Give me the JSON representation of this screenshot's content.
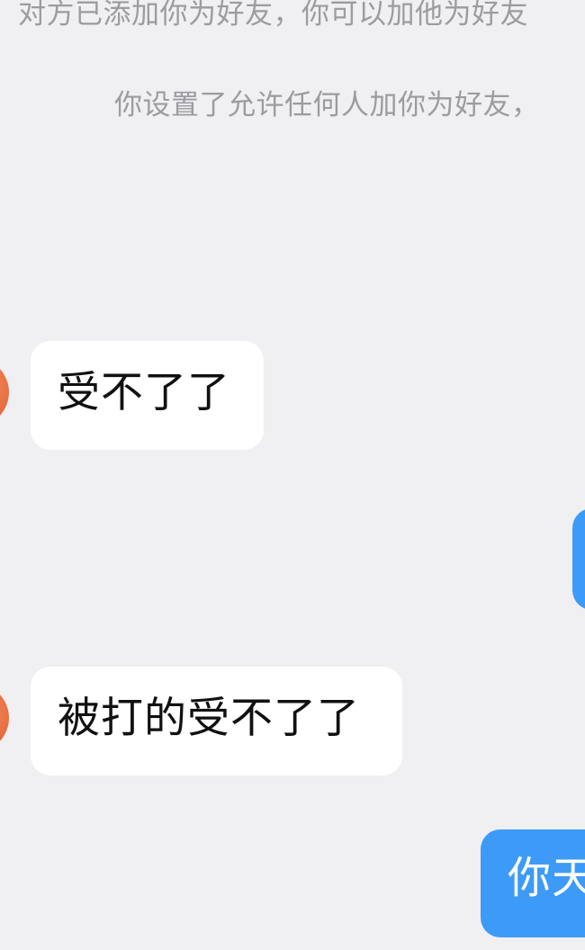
{
  "system_notes": {
    "added_notice": "对方已添加你为好友，你可以加他为好友",
    "settings_notice": "你设置了允许任何人加你为好友，"
  },
  "messages": [
    {
      "side": "incoming",
      "text": "受不了了"
    },
    {
      "side": "outgoing",
      "text": ""
    },
    {
      "side": "incoming",
      "text": "被打的受不了了"
    },
    {
      "side": "outgoing",
      "text": "你天"
    }
  ],
  "colors": {
    "background": "#f0eff1",
    "incoming_bubble": "#ffffff",
    "outgoing_bubble": "#3d9bf7",
    "system_text": "#9b9ba1",
    "avatar": "#e5683c"
  }
}
